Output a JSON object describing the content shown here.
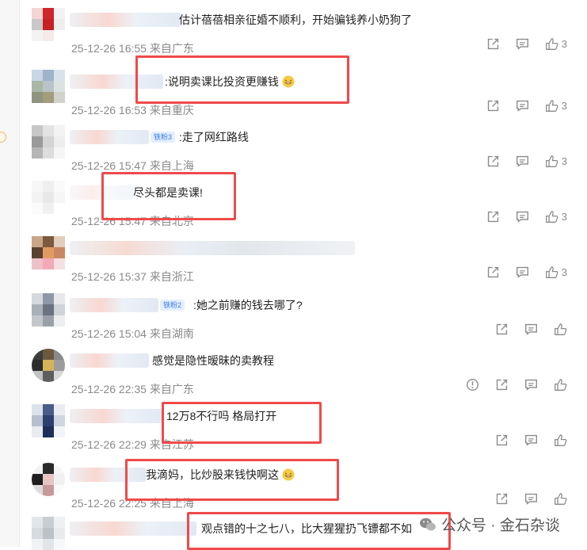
{
  "comments": [
    {
      "text": "估计蓓蓓相亲征婚不顺利，开始骗钱养小奶狗了",
      "time": "25-12-26 16:55",
      "source": "来自广东",
      "likes": "3"
    },
    {
      "text": "说明卖课比投资更赚钱",
      "time": "25-12-26 16:53",
      "source": "来自重庆",
      "likes": "3"
    },
    {
      "badge": "铁粉3",
      "text": ":走了网红路线",
      "time": "25-12-26 15:47",
      "source": "来自上海",
      "likes": "3"
    },
    {
      "text": "尽头都是卖课!",
      "time": "25-12-26 15:47",
      "source": "来自北京",
      "likes": "3"
    },
    {
      "text": "",
      "time": "25-12-26 15:37",
      "source": "来自浙江",
      "likes": "3"
    },
    {
      "badge": "铁粉2",
      "text": ":她之前赚的钱去哪了?",
      "time": "25-12-26 15:04",
      "source": "来自湖南",
      "likes": ""
    },
    {
      "text": "感觉是隐性暧昧的卖教程",
      "time": "25-12-26 22:35",
      "source": "来自广东",
      "likes": ""
    },
    {
      "text": "12万8不行吗  格局打开",
      "time": "25-12-26 22:29",
      "source": "来自江苏",
      "likes": ""
    },
    {
      "text": "我滴妈，比炒股来钱快啊这",
      "time": "25-12-26 22:25",
      "source": "来自上海",
      "likes": ""
    },
    {
      "text": "观点错的十之七八，比大猩猩扔飞镖都不如",
      "time": "",
      "source": "",
      "likes": ""
    }
  ],
  "watermark": {
    "text": "公众号 · 金石杂谈"
  },
  "icons": {
    "share": "share-icon",
    "comment": "comment-icon",
    "like": "thumbs-up-icon",
    "report": "report-icon",
    "emoji": "laugh-emoji-icon"
  },
  "colors": {
    "highlight": "#ef4a4a",
    "meta": "#8a8a8a",
    "badge": "#3c7be6"
  }
}
